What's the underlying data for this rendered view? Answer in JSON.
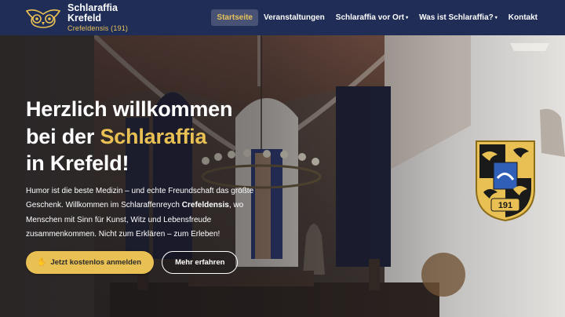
{
  "header": {
    "logo_icon": "owl-logo-icon",
    "title_line1": "Schlaraffia",
    "title_line2": "Krefeld",
    "subtitle": "Crefeldensis (191)"
  },
  "nav": {
    "items": [
      {
        "label": "Startseite",
        "active": true,
        "has_dropdown": false
      },
      {
        "label": "Veranstaltungen",
        "active": false,
        "has_dropdown": false
      },
      {
        "label": "Schlaraffia vor Ort",
        "active": false,
        "has_dropdown": true
      },
      {
        "label": "Was ist Schlaraffia?",
        "active": false,
        "has_dropdown": true
      },
      {
        "label": "Kontakt",
        "active": false,
        "has_dropdown": false
      }
    ],
    "caret": "▾"
  },
  "hero": {
    "line1": "Herzlich willkommen",
    "line2_prefix": "bei der ",
    "line2_accent": "Schlaraffia",
    "line3": "in Krefeld!",
    "p_part1": "Humor ist die beste Medizin – und echte Freundschaft das größte Geschenk. Willkommen im Schlaraffenreych ",
    "p_bold": "Crefeldensis",
    "p_part2": ", wo Menschen mit Sinn für Kunst, Witz und Lebensfreude zusammenkommen. Nicht zum Erklären – zum Erleben!"
  },
  "buttons": {
    "primary_icon": "hand-icon",
    "primary_label": "Jetzt kostenlos anmelden",
    "secondary_label": "Mehr erfahren"
  },
  "crest": {
    "number": "191",
    "icon": "schlaraffia-crest-icon"
  },
  "colors": {
    "navy": "#1f2d57",
    "gold": "#e9c053"
  }
}
